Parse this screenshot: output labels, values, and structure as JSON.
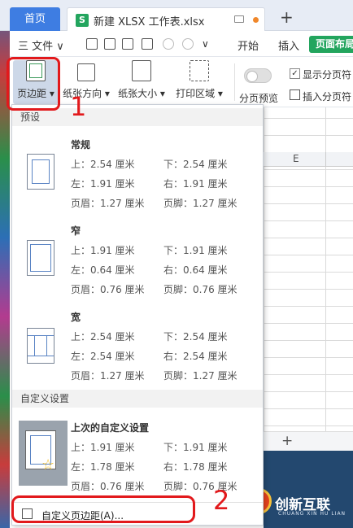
{
  "tabs": {
    "home": "首页",
    "file": "新建 XLSX 工作表.xlsx",
    "file_icon": "S",
    "new_tab": "+"
  },
  "menu": {
    "file": "三 文件 ∨",
    "start": "开始",
    "insert": "插入",
    "page_layout": "页面布局"
  },
  "ribbon": {
    "margins": "页边距 ▾",
    "orientation": "纸张方向 ▾",
    "size": "纸张大小 ▾",
    "print_area": "打印区域 ▾",
    "page_break_preview": "分页预览",
    "show_page_breaks": "显示分页符",
    "insert_page_break": "插入分页符"
  },
  "sheet": {
    "column": "E",
    "add_sheet": "+"
  },
  "dropdown": {
    "section_presets": "预设",
    "presets": [
      {
        "name": "常规",
        "top": "上：2.54 厘米",
        "bottom": "下：2.54 厘米",
        "left": "左：1.91 厘米",
        "right": "右：1.91 厘米",
        "header": "页眉：1.27 厘米",
        "footer": "页脚：1.27 厘米"
      },
      {
        "name": "窄",
        "top": "上：1.91 厘米",
        "bottom": "下：1.91 厘米",
        "left": "左：0.64 厘米",
        "right": "右：0.64 厘米",
        "header": "页眉：0.76 厘米",
        "footer": "页脚：0.76 厘米"
      },
      {
        "name": "宽",
        "top": "上：2.54 厘米",
        "bottom": "下：2.54 厘米",
        "left": "左：2.54 厘米",
        "right": "右：2.54 厘米",
        "header": "页眉：1.27 厘米",
        "footer": "页脚：1.27 厘米"
      }
    ],
    "section_custom": "自定义设置",
    "last_custom": {
      "name": "上次的自定义设置",
      "top": "上：1.91 厘米",
      "bottom": "下：1.91 厘米",
      "left": "左：1.78 厘米",
      "right": "右：1.78 厘米",
      "header": "页眉：0.76 厘米",
      "footer": "页脚：0.76 厘米"
    },
    "custom_margins": "自定义页边距(A)..."
  },
  "annotations": {
    "step1": "1",
    "step2": "2"
  },
  "watermark": {
    "main": "创新互联",
    "sub": "CHUANG XIN HU LIAN"
  },
  "colors": {
    "accent": "#3e7de2",
    "green": "#23a55e",
    "annotation": "#e2191c"
  }
}
